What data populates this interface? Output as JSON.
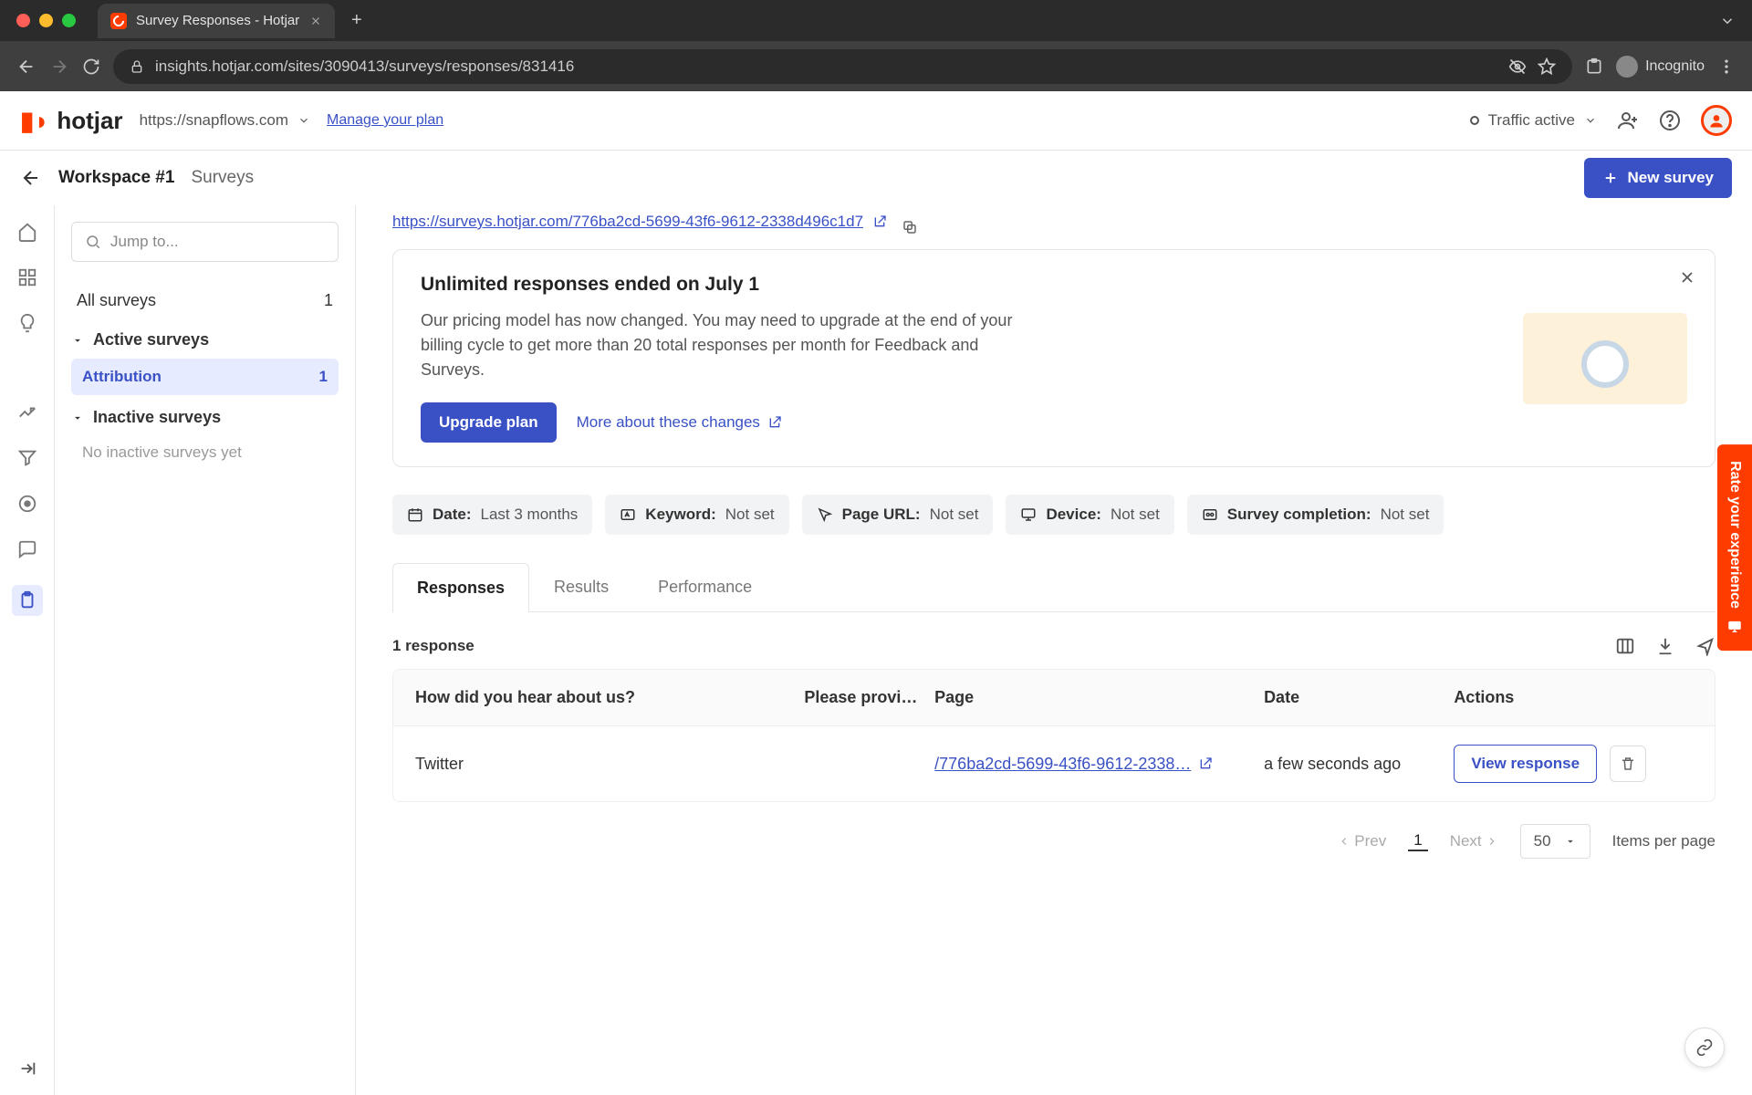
{
  "browser": {
    "tab_title": "Survey Responses - Hotjar",
    "url": "insights.hotjar.com/sites/3090413/surveys/responses/831416",
    "incognito_label": "Incognito"
  },
  "topbar": {
    "logo_text": "hotjar",
    "site": "https://snapflows.com",
    "manage_plan": "Manage your plan",
    "traffic_label": "Traffic active"
  },
  "header": {
    "workspace": "Workspace #1",
    "crumb": "Surveys",
    "new_survey": "New survey"
  },
  "sidebar": {
    "jump_placeholder": "Jump to...",
    "all_surveys_label": "All surveys",
    "all_surveys_count": "1",
    "active_label": "Active surveys",
    "active_items": [
      {
        "label": "Attribution",
        "count": "1"
      }
    ],
    "inactive_label": "Inactive surveys",
    "inactive_empty": "No inactive surveys yet"
  },
  "survey_link": "https://surveys.hotjar.com/776ba2cd-5699-43f6-9612-2338d496c1d7",
  "notice": {
    "title": "Unlimited responses ended on July 1",
    "body": "Our pricing model has now changed. You may need to upgrade at the end of your billing cycle to get more than 20 total responses per month for Feedback and Surveys.",
    "upgrade": "Upgrade plan",
    "more": "More about these changes"
  },
  "filters": [
    {
      "label": "Date:",
      "value": "Last 3 months"
    },
    {
      "label": "Keyword:",
      "value": "Not set"
    },
    {
      "label": "Page URL:",
      "value": "Not set"
    },
    {
      "label": "Device:",
      "value": "Not set"
    },
    {
      "label": "Survey completion:",
      "value": "Not set"
    }
  ],
  "tabs": {
    "responses": "Responses",
    "results": "Results",
    "performance": "Performance"
  },
  "responses": {
    "count_label": "1 response",
    "columns": {
      "q1": "How did you hear about us?",
      "q2": "Please provi…",
      "page": "Page",
      "date": "Date",
      "actions": "Actions"
    },
    "rows": [
      {
        "q1": "Twitter",
        "q2": "",
        "page": "/776ba2cd-5699-43f6-9612-2338…",
        "date": "a few seconds ago",
        "view": "View response"
      }
    ]
  },
  "pager": {
    "prev": "Prev",
    "current": "1",
    "next": "Next",
    "per_page": "50",
    "per_page_label": "Items per page"
  },
  "feedback_tab": "Rate your experience"
}
